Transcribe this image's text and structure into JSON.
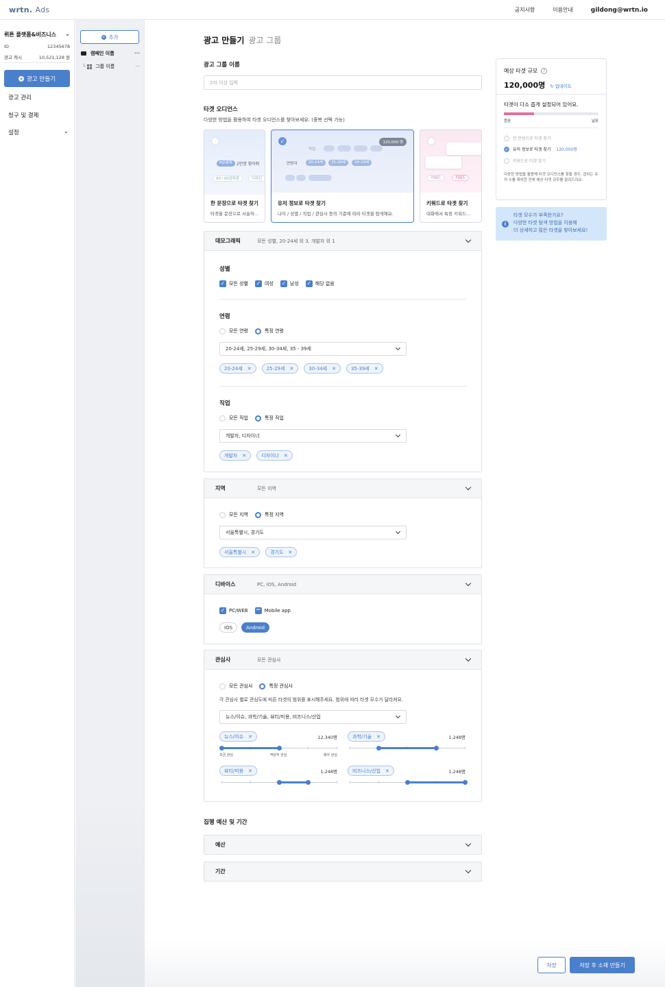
{
  "app": {
    "logo": "wrtn.",
    "logo_suffix": "Ads"
  },
  "topnav": {
    "notice": "공지사항",
    "guide": "이용안내",
    "email": "gildong@wrtn.io"
  },
  "sidebar": {
    "brand": "뤼튼 플랫폼&비즈니스",
    "id_label": "ID",
    "id_value": "12345678",
    "cash_label": "광고 캐시",
    "cash_value": "10,521,128 원",
    "create_label": "광고 만들기",
    "items": [
      {
        "label": "광고 관리"
      },
      {
        "label": "청구 및 결제"
      },
      {
        "label": "설정"
      }
    ]
  },
  "tree": {
    "add_label": "추가",
    "campaign": "캠페인 이름",
    "group": "그룹 이름",
    "more": "···"
  },
  "page": {
    "title": "광고 만들기",
    "subtitle": "광고 그룹"
  },
  "group_name": {
    "label": "광고 그룹 이름",
    "placeholder": "2자 이상 입력"
  },
  "audience": {
    "label": "타겟 오디언스",
    "desc": "다양한 방법을 활용하여 타겟 오디언스를 찾아보세요. (중복 선택 가능)",
    "cards": [
      {
        "title": "한 문장으로 타겟 찾기",
        "desc": "타겟을 문장으로 서술하...",
        "art": [
          "MZ세대",
          "2만명 찾아줘",
          "90~00년대생",
          "디자인"
        ]
      },
      {
        "title": "유저 정보로 타겟 찾기",
        "desc": "나이 / 성별 / 직업 / 관심사 등의 기준에 따라 타겟을 탐색해요.",
        "badge": "120,000 명",
        "art": [
          "직업",
          "연령대",
          "20-24세",
          "25-29세",
          "24-29세"
        ]
      },
      {
        "title": "키워드로 타겟 찾기",
        "desc": "대화에서 특정 키워드...",
        "art": [
          "키워드",
          "키워드"
        ]
      }
    ]
  },
  "demographic": {
    "title": "데모그래픽",
    "summary": "모든 성별, 20-24세 외 3, 개발자 외 1",
    "gender": {
      "label": "성별",
      "options": [
        "모든 성별",
        "여성",
        "남성",
        "해당 없음"
      ]
    },
    "age": {
      "label": "연령",
      "all": "모든 연령",
      "specific": "특정 연령",
      "selected": "20-24세, 25-29세, 30-34세, 35 - 39세",
      "tags": [
        "20-24세",
        "25-29세",
        "30-34세",
        "35-39세"
      ]
    },
    "job": {
      "label": "직업",
      "all": "모든 직업",
      "specific": "특정 직업",
      "selected": "개발자, 디자이너",
      "tags": [
        "개발자",
        "디자이너"
      ]
    }
  },
  "region": {
    "title": "지역",
    "summary": "모든 지역",
    "all": "모든 지역",
    "specific": "특정 지역",
    "selected": "서울특별시, 경기도",
    "tags": [
      "서울특별시",
      "경기도"
    ]
  },
  "device": {
    "title": "디바이스",
    "summary": "PC, IOS, Android",
    "pc": "PC/WEB",
    "mobile": "Mobile app",
    "ios": "IOS",
    "android": "Android"
  },
  "interest": {
    "title": "관심사",
    "summary": "모든 관심사",
    "all": "모든 관심사",
    "specific": "특정 관심사",
    "desc": "각 관심사 별로 관심도에 따른 타겟의 범위를 표시해주세요. 범위에 따라 타겟 모수가 달라져요.",
    "selected": "뉴스/이슈, 과학/기술, 뷰티/미용, 비즈니스/산업",
    "scale_labels": [
      "조금 관심",
      "적당히 관심",
      "매우 관심"
    ],
    "items": [
      {
        "tag": "뉴스/이슈",
        "count": "12,340명",
        "range": [
          0,
          0.5
        ]
      },
      {
        "tag": "과학/기술",
        "count": "1,248명",
        "range": [
          0.25,
          0.75
        ]
      },
      {
        "tag": "뷰티/미용",
        "count": "1,248명",
        "range": [
          0.5,
          0.75
        ]
      },
      {
        "tag": "비즈니스/산업",
        "count": "1,248명",
        "range": [
          0.5,
          1
        ]
      }
    ]
  },
  "budget": {
    "label": "집행 예산 및 기간",
    "budget": "예산",
    "period": "기간"
  },
  "estimate": {
    "title": "예상 타겟 규모",
    "value": "120,000명",
    "update": "업데이트",
    "message": "타겟이 다소 좁게 설정되어 있어요.",
    "level": 0.32,
    "narrow": "좁음",
    "wide": "넓음",
    "options": [
      {
        "label": "한 문장으로 타겟 찾기"
      },
      {
        "label": "유저 정보로 타겟 찾기",
        "value": "120,000명"
      },
      {
        "label": "키워드로 타겟 찾기"
      }
    ],
    "note": "다양한 방법을 활용해 타겟 오디언스를 찾을 경우, 겹치는 유저 수를 제외한 전체 예상 타겟 규모를 알려드려요."
  },
  "tip": {
    "line1": "타겟 모수가 부족한가요?",
    "line2": "다양한 타겟 탐색 방법을 이용해",
    "line3": "더 상세하고 많은 타겟을 찾아보세요!"
  },
  "footer": {
    "save": "저장",
    "save_and_create": "저장 후 소재 만들기"
  }
}
